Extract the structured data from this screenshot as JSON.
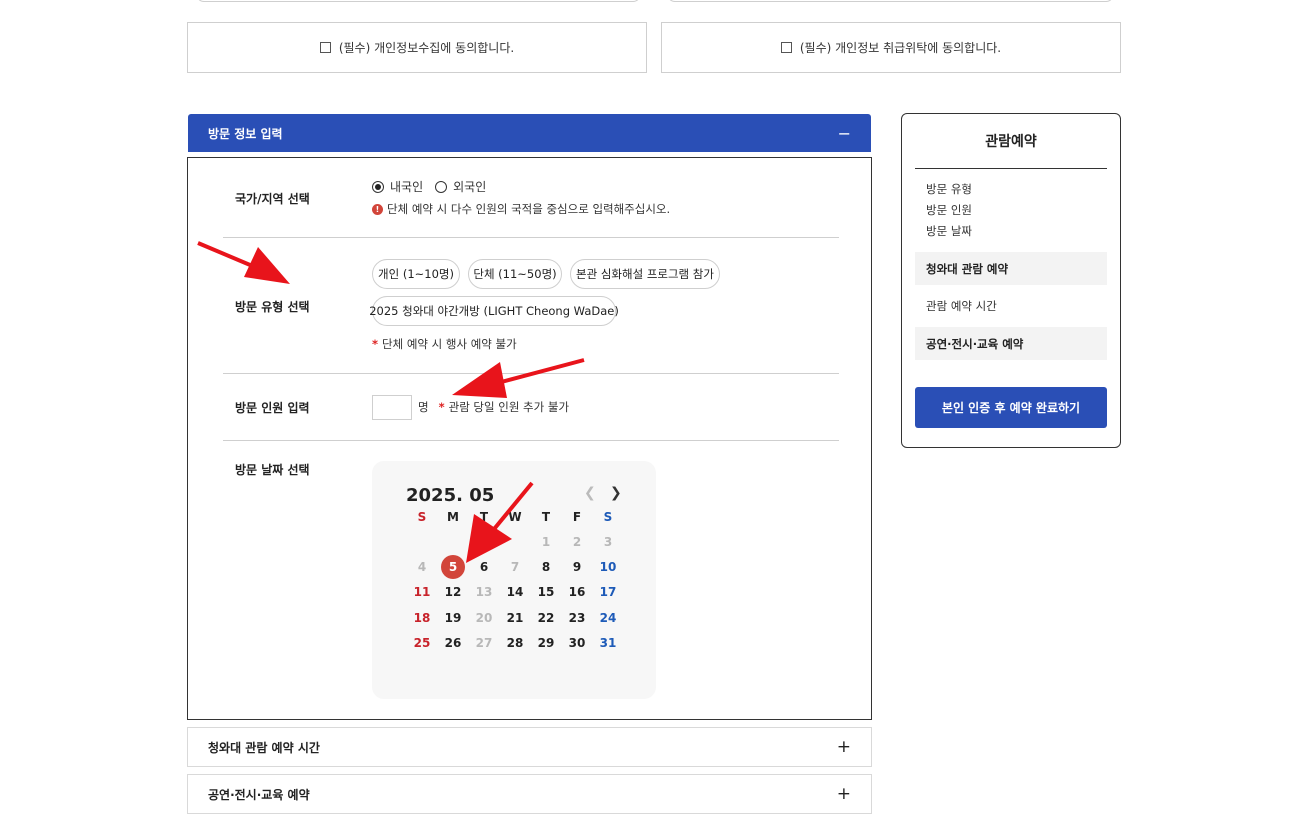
{
  "agreements": [
    {
      "label": "(필수) 개인정보수집에 동의합니다."
    },
    {
      "label": "(필수) 개인정보 취급위탁에 동의합니다."
    }
  ],
  "visit_panel": {
    "title": "방문 정보 입력",
    "toggle": "−",
    "country": {
      "label": "국가/지역 선택",
      "options": [
        "내국인",
        "외국인"
      ],
      "selected": "내국인",
      "note": "단체 예약 시 다수 인원의 국적을 중심으로 입력해주십시오."
    },
    "type": {
      "label": "방문 유형 선택",
      "chips": [
        "개인 (1~10명)",
        "단체 (11~50명)",
        "본관 심화해설 프로그램 참가",
        "2025 청와대 야간개방 (LIGHT Cheong WaDae)"
      ],
      "note": "단체 예약 시 행사 예약 불가"
    },
    "count": {
      "label": "방문 인원 입력",
      "value": "",
      "unit": "명",
      "note": "관람 당일 인원 추가 불가"
    },
    "date": {
      "label": "방문 날짜 선택"
    }
  },
  "calendar": {
    "title": "2025. 05",
    "prev": "‹",
    "next": "›",
    "weekdays": [
      "S",
      "M",
      "T",
      "W",
      "T",
      "F",
      "S"
    ],
    "weeks": [
      [
        "",
        "",
        "",
        "",
        "1",
        "2",
        "3"
      ],
      [
        "4",
        "5",
        "6",
        "7",
        "8",
        "9",
        "10"
      ],
      [
        "11",
        "12",
        "13",
        "14",
        "15",
        "16",
        "17"
      ],
      [
        "18",
        "19",
        "20",
        "21",
        "22",
        "23",
        "24"
      ],
      [
        "25",
        "26",
        "27",
        "28",
        "29",
        "30",
        "31"
      ]
    ],
    "disabled": [
      "1",
      "2",
      "3",
      "4",
      "7",
      "13",
      "20",
      "27"
    ],
    "selected": "5"
  },
  "accordions": [
    {
      "label": "청와대 관람 예약 시간",
      "icon": "+"
    },
    {
      "label": "공연·전시·교육 예약",
      "icon": "+"
    }
  ],
  "sidebar": {
    "title": "관람예약",
    "items": [
      "방문 유형",
      "방문 인원",
      "방문 날짜"
    ],
    "sections": [
      "청와대 관람 예약",
      "관람 예약 시간",
      "공연·전시·교육 예약"
    ],
    "button": "본인 인증 후 예약 완료하기"
  },
  "colors": {
    "primary": "#2a4fb6",
    "accent_red": "#d2453a",
    "arrow": "#e8141b",
    "sunday": "#c8232b",
    "saturday": "#1e5bb8"
  }
}
